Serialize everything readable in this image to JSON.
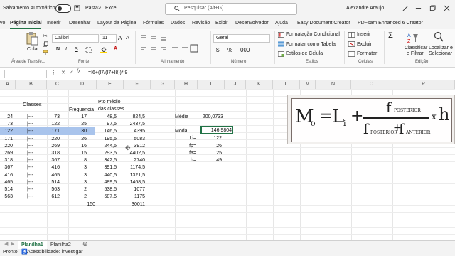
{
  "titlebar": {
    "autosave_label": "Salvamento Automático",
    "doc_name": "Pasta2",
    "app_sep": "-",
    "app_name": "Excel",
    "search_placeholder": "Pesquisar (Alt+G)",
    "user_name": "Alexandre Araujo"
  },
  "menu": [
    "vo",
    "Página Inicial",
    "Inserir",
    "Desenhar",
    "Layout da Página",
    "Fórmulas",
    "Dados",
    "Revisão",
    "Exibir",
    "Desenvolvedor",
    "Ajuda",
    "Easy Document Creator",
    "PDFsam Enhanced 6 Creator"
  ],
  "ribbon": {
    "paste": "Colar",
    "clipboard_group": "Área de Transfe...",
    "font_name": "Calibri",
    "font_size": "11",
    "bold": "N",
    "italic": "I",
    "underline": "S",
    "font_group": "Fonte",
    "align_group": "Alinhamento",
    "number_format": "Geral",
    "number_group": "Número",
    "cond_format": "Formatação Condicional",
    "format_table": "Formatar como Tabela",
    "cell_styles": "Estilos de Célula",
    "styles_group": "Estilos",
    "insert": "Inserir",
    "delete": "Excluir",
    "format": "Formatar",
    "cells_group": "Células",
    "sort_filter_1": "Classificar",
    "sort_filter_2": "e Filtrar",
    "find_select_1": "Localizar e",
    "find_select_2": "Selecionar",
    "edit_group": "Edição"
  },
  "formula_bar": {
    "fx": "fx",
    "formula": "=I6+(I7/(I7+I8))*I9"
  },
  "columns": [
    "A",
    "B",
    "C",
    "D",
    "E",
    "F",
    "G",
    "H",
    "I",
    "J",
    "K",
    "L",
    "M",
    "N",
    "O",
    "P"
  ],
  "table": {
    "header_classes": "Classes",
    "header_freq": "Frequencia",
    "header_pto_1": "Pto médio",
    "header_pto_2": "das classes",
    "rows": [
      {
        "a": "24",
        "b": "|---",
        "c": "73",
        "d": "17",
        "e": "48,5",
        "f": "824,5"
      },
      {
        "a": "73",
        "b": "|---",
        "c": "122",
        "d": "25",
        "e": "97,5",
        "f": "2437,5"
      },
      {
        "a": "122",
        "b": "|---",
        "c": "171",
        "d": "30",
        "e": "146,5",
        "f": "4395"
      },
      {
        "a": "171",
        "b": "|---",
        "c": "220",
        "d": "26",
        "e": "195,5",
        "f": "5083"
      },
      {
        "a": "220",
        "b": "|---",
        "c": "269",
        "d": "16",
        "e": "244,5",
        "f": "3912"
      },
      {
        "a": "269",
        "b": "|---",
        "c": "318",
        "d": "15",
        "e": "293,5",
        "f": "4402,5"
      },
      {
        "a": "318",
        "b": "|---",
        "c": "367",
        "d": "8",
        "e": "342,5",
        "f": "2740"
      },
      {
        "a": "367",
        "b": "|---",
        "c": "416",
        "d": "3",
        "e": "391,5",
        "f": "1174,5"
      },
      {
        "a": "416",
        "b": "|---",
        "c": "465",
        "d": "3",
        "e": "440,5",
        "f": "1321,5"
      },
      {
        "a": "465",
        "b": "|---",
        "c": "514",
        "d": "3",
        "e": "489,5",
        "f": "1468,5"
      },
      {
        "a": "514",
        "b": "|---",
        "c": "563",
        "d": "2",
        "e": "538,5",
        "f": "1077"
      },
      {
        "a": "563",
        "b": "|---",
        "c": "612",
        "d": "2",
        "e": "587,5",
        "f": "1175"
      }
    ],
    "total_freq": "150",
    "total_sum": "30011"
  },
  "stats": {
    "media_label": "Média",
    "media_value": "200,0733",
    "moda_label": "Moda",
    "moda_value": "146,9804",
    "li_label": "Li=",
    "li_value": "122",
    "fp_label": "fp=",
    "fp_value": "26",
    "fa_label": "fa=",
    "fa_value": "25",
    "h_label": "h=",
    "h_value": "49"
  },
  "formula_image": {
    "mo": "M",
    "mo_sub": "o",
    "eq": "=",
    "li": "L",
    "li_sub": "i",
    "plus": "+",
    "f_num": "f",
    "f_num_sub": "POSTERIOR",
    "f_den1": "f",
    "f_den1_sub": "POSTERIOR",
    "plus2": "+",
    "f_den2": "f",
    "f_den2_sub": "ANTERIOR",
    "times": "x",
    "h": "h"
  },
  "sheets": [
    "Planilha1",
    "Planilha2"
  ],
  "status": {
    "ready": "Pronto",
    "accessibility": "Acessibilidade: investigar"
  },
  "colors": {
    "excel_green": "#217346",
    "selection": "#a9c4ec"
  }
}
